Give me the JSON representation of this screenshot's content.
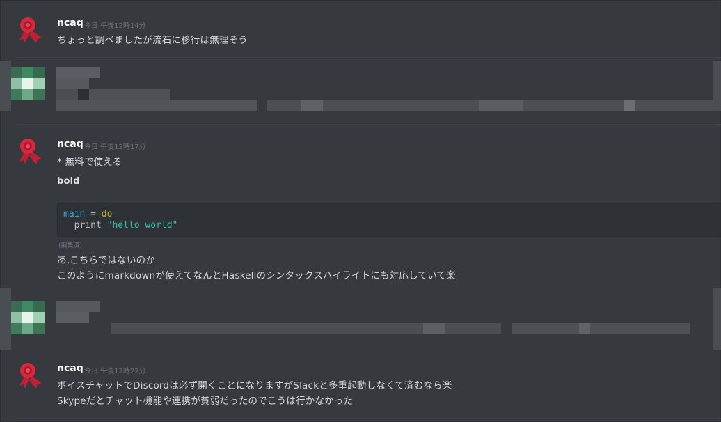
{
  "messages": [
    {
      "username": "ncaq",
      "timestamp": "今日 午後12時14分",
      "lines": [
        "ちょっと調べましたが流石に移行は無理そう"
      ]
    },
    {
      "username": "ncaq",
      "timestamp": "今日 午後12時17分",
      "list_item": "* 無料で使える",
      "bold_text": "bold",
      "code": {
        "line1_ident": "main",
        "line1_op": " = ",
        "line1_kw": "do",
        "line2_fn": "  print ",
        "line2_str": "\"hello world\""
      },
      "edited_label": "(編集済)",
      "lines": [
        "あ,こちらではないのか",
        "このようにmarkdownが使えてなんとHaskellのシンタックスハイライトにも対応していて楽"
      ]
    },
    {
      "username": "ncaq",
      "timestamp": "今日 午後12時22分",
      "lines": [
        "ボイスチャットでDiscordは必ず開くことになりますがSlackと多重起動しなくて済むなら楽",
        "Skypeだとチャット機能や連携が貧弱だったのでこうは行かなかった"
      ]
    }
  ],
  "colors": {
    "background": "#36393e",
    "username": "#ffffff",
    "text": "#dcddde",
    "timestamp": "#6f7378",
    "code_bg": "#2e3136",
    "avatar_red": "#d6293f"
  },
  "icons": {
    "avatar": "red-rosette-avatar-icon",
    "redacted_avatar": "pixelated-avatar-icon"
  }
}
